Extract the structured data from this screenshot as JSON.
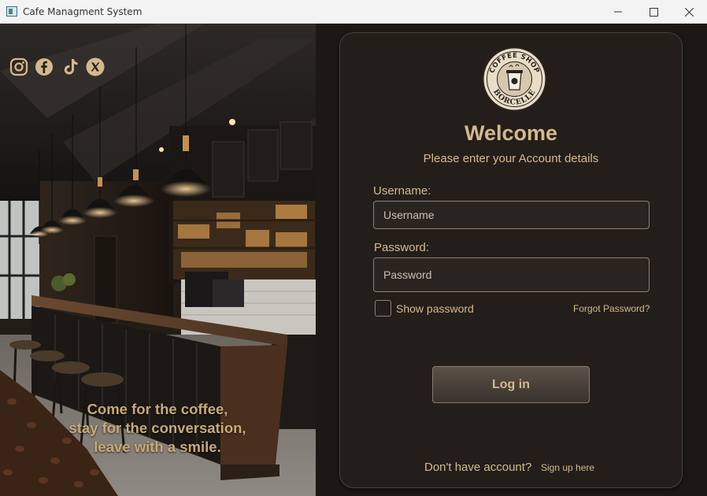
{
  "window": {
    "title": "Cafe Managment System",
    "minimize_glyph": "—",
    "maximize_glyph": "☐",
    "close_glyph": "✕"
  },
  "social_icons": [
    "instagram-icon",
    "facebook-icon",
    "tiktok-icon",
    "x-icon"
  ],
  "tagline": {
    "line1": "Come for the coffee,",
    "line2": "stay for the conversation,",
    "line3": "leave with a smile."
  },
  "logo": {
    "top_text": "COFFEE SHOP",
    "bottom_text": "BORCELLE"
  },
  "login": {
    "welcome": "Welcome",
    "subtitle": "Please enter your Account details",
    "username_label": "Username:",
    "username_placeholder": "Username",
    "password_label": "Password:",
    "password_placeholder": "Password",
    "show_password": "Show password",
    "forgot_password": "Forgot Password?",
    "login_button": "Log in",
    "no_account": "Don't have account?",
    "signup": "Sign up here"
  },
  "colors": {
    "accent": "#d4b98d",
    "panel": "#231e1a",
    "border": "#8b8178"
  }
}
